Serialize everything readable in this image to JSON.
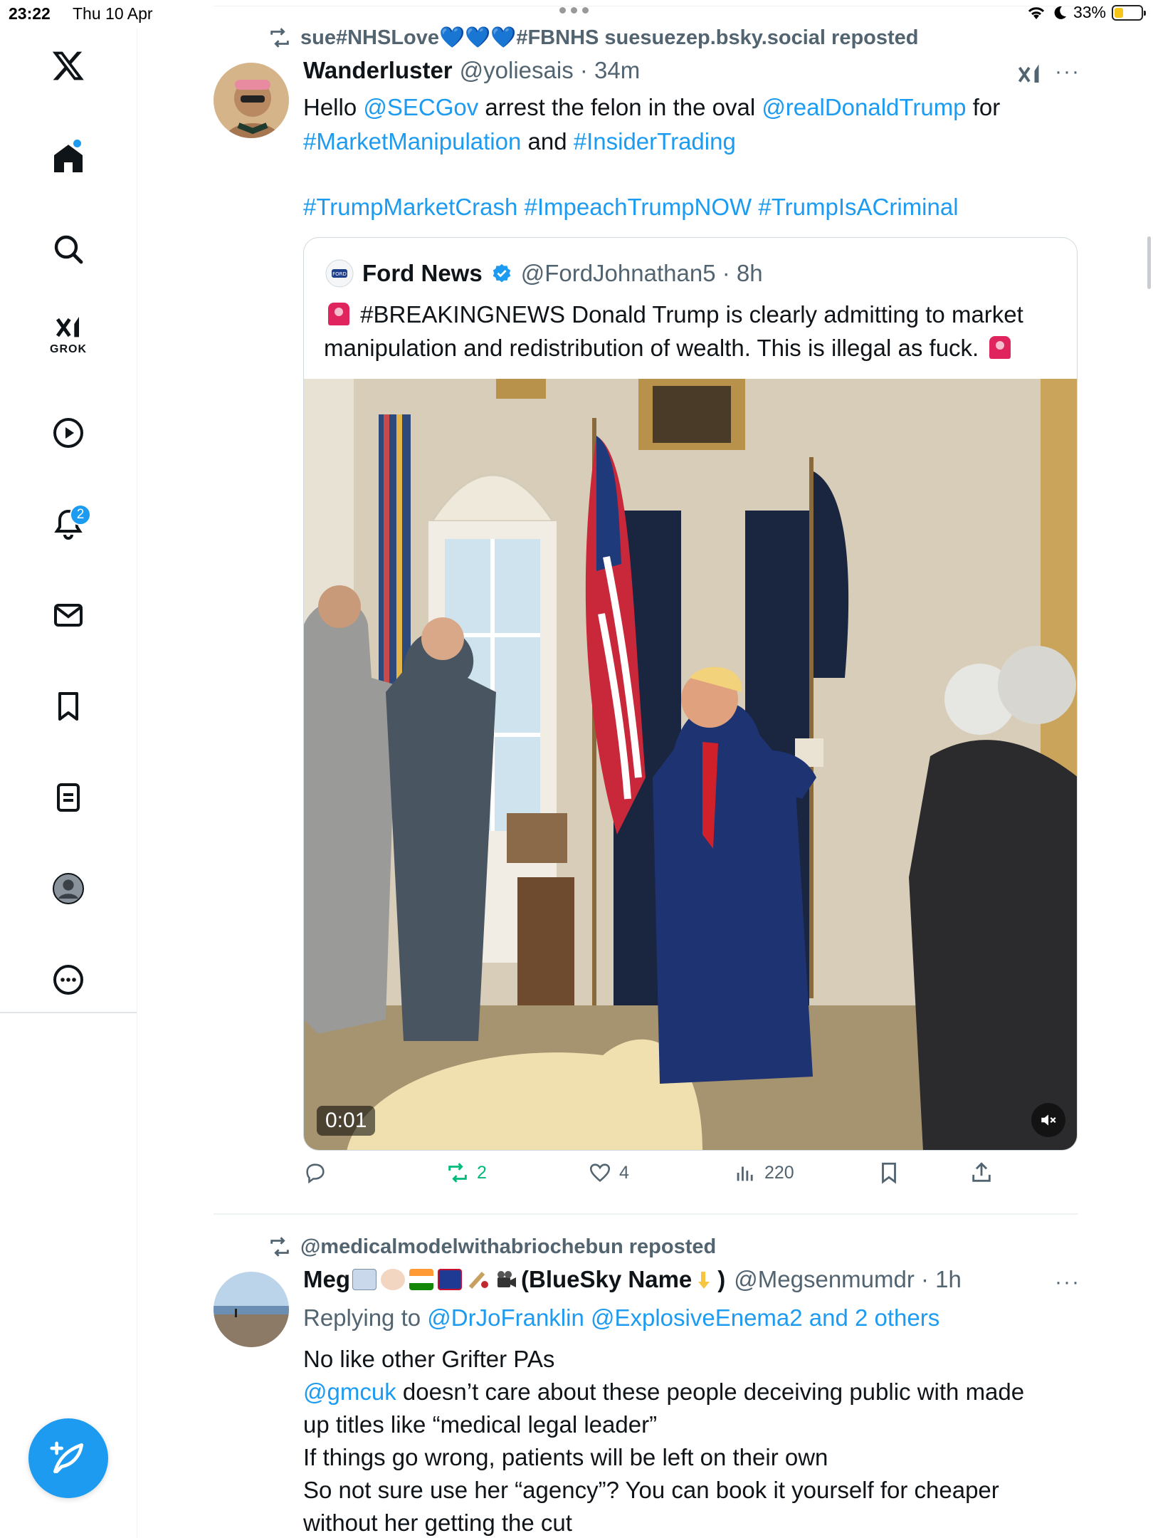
{
  "status_bar": {
    "time": "23:22",
    "date": "Thu 10 Apr",
    "battery": "33%"
  },
  "sidebar": {
    "items": [
      {
        "name": "x-logo"
      },
      {
        "name": "home",
        "badge_dot": true
      },
      {
        "name": "explore"
      },
      {
        "name": "grok",
        "label": "GROK"
      },
      {
        "name": "videos"
      },
      {
        "name": "notifications",
        "badge": "2"
      },
      {
        "name": "messages"
      },
      {
        "name": "bookmarks"
      },
      {
        "name": "lists"
      },
      {
        "name": "profile"
      },
      {
        "name": "more"
      }
    ]
  },
  "feed": {
    "post1": {
      "repost_text": "sue#NHSLove💙💙💙#FBNHS suesuezep.bsky.social reposted",
      "name": "Wanderluster",
      "handle": "@yoliesais · 34m",
      "text": {
        "l1_a": "Hello ",
        "l1_link1": "@SECGov",
        "l1_b": " arrest the felon in the oval ",
        "l1_link2": "@realDonaldTrump",
        "l1_c": " for",
        "l2_link1": "#MarketManipulation",
        "l2_a": " and ",
        "l2_link2": "#InsiderTrading",
        "l3": "#TrumpMarketCrash #ImpeachTrumpNOW #TrumpIsACriminal"
      },
      "quote": {
        "name": "Ford News",
        "handle": "@FordJohnathan5 · 8h",
        "line1": "#BREAKINGNEWS Donald Trump is clearly admitting to market",
        "line2": "manipulation and redistribution of wealth. This is illegal as fuck.",
        "video_time": "0:01"
      },
      "actions": {
        "reposts": "2",
        "likes": "4",
        "views": "220"
      }
    },
    "post2": {
      "repost_text": "@medicalmodelwithabriochebun reposted",
      "name_prefix": "Meg",
      "name_suffix": "(BlueSky Name",
      "name_close": ")",
      "handle": "@Megsenmumdr · 1h",
      "reply_prefix": "Replying to ",
      "reply_links": "@DrJoFranklin @ExplosiveEnema2 and 2 others",
      "line1": "No like other Grifter PAs",
      "line2_link": "@gmcuk",
      "line2": " doesn’t care about these people deceiving public with made",
      "line3": "up titles like “medical legal leader”",
      "line4": "If things go wrong, patients will be left on their own",
      "line5": "So not sure use her “agency”? You can book it yourself for cheaper",
      "line6": "without her getting the cut"
    }
  },
  "colors": {
    "accent": "#1d9bf0",
    "repost_green": "#00ba7c",
    "muted": "#536471",
    "text": "#0f1419"
  }
}
